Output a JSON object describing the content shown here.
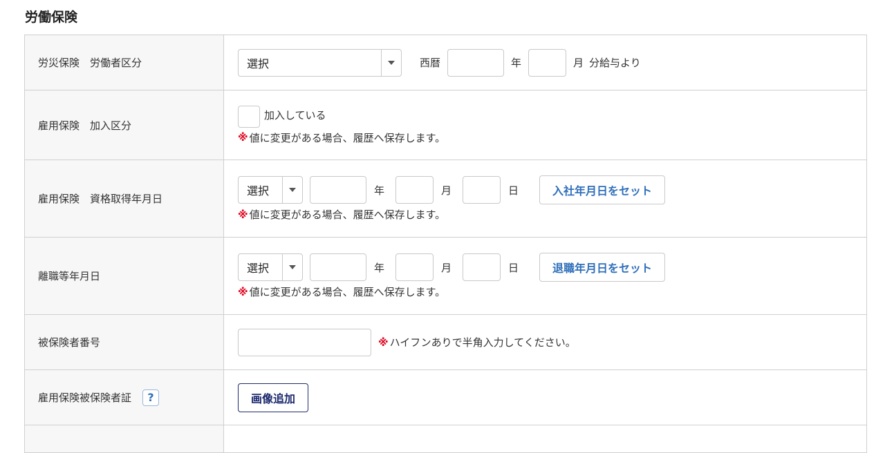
{
  "section": {
    "title": "労働保険"
  },
  "rows": {
    "rousai": {
      "label": "労災保険　労働者区分",
      "select_value": "選択",
      "era_label": "西暦",
      "year_unit": "年",
      "month_unit": "月",
      "suffix": "分給与より",
      "year_value": "",
      "month_value": ""
    },
    "koyou_kanyu": {
      "label": "雇用保険　加入区分",
      "checkbox_label": "加入している",
      "note_mark": "※",
      "note": "値に変更がある場合、履歴へ保存します。"
    },
    "shikaku": {
      "label": "雇用保険　資格取得年月日",
      "select_value": "選択",
      "year_unit": "年",
      "month_unit": "月",
      "day_unit": "日",
      "button": "入社年月日をセット",
      "note_mark": "※",
      "note": "値に変更がある場合、履歴へ保存します。"
    },
    "rishoku": {
      "label": "離職等年月日",
      "select_value": "選択",
      "year_unit": "年",
      "month_unit": "月",
      "day_unit": "日",
      "button": "退職年月日をセット",
      "note_mark": "※",
      "note": "値に変更がある場合、履歴へ保存します。"
    },
    "hihokensha": {
      "label": "被保険者番号",
      "value": "",
      "note_mark": "※",
      "note": "ハイフンありで半角入力してください。"
    },
    "shou": {
      "label": "雇用保険被保険者証",
      "help": "?",
      "button": "画像追加"
    }
  },
  "colors": {
    "note_mark": "#e0001b",
    "link_blue": "#2f6fba",
    "navy": "#1d2a6e"
  }
}
